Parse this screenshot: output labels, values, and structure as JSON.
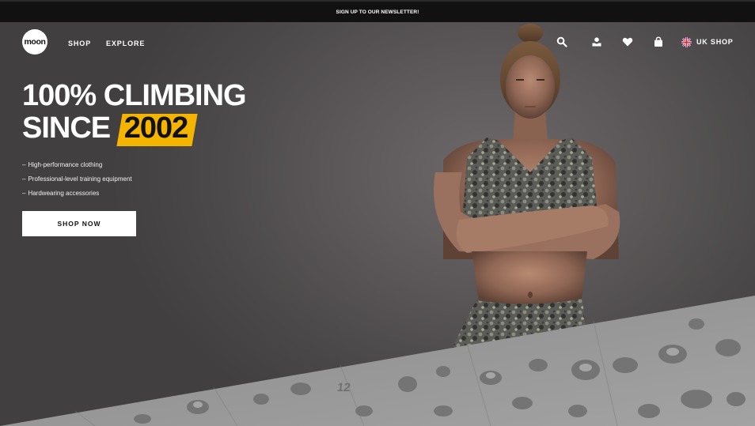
{
  "announcement": {
    "text": "SIGN UP TO OUR NEWSLETTER!"
  },
  "header": {
    "logo_text": "moon",
    "nav": [
      {
        "label": "SHOP"
      },
      {
        "label": "EXPLORE"
      }
    ],
    "utility_icons": [
      "search-icon",
      "account-icon",
      "heart-icon",
      "bag-icon"
    ],
    "shop_switch": {
      "flag_icon": "uk-flag-icon",
      "label": "UK SHOP"
    }
  },
  "hero": {
    "headline_line1": "100% CLIMBING",
    "headline_line2_prefix": "SINCE",
    "headline_highlight": "2002",
    "bullets": [
      {
        "dash": "–",
        "text": "High-performance clothing"
      },
      {
        "dash": "–",
        "text": "Professional-level training equipment"
      },
      {
        "dash": "–",
        "text": "Hardwearing accessories"
      }
    ],
    "cta_label": "SHOP NOW",
    "panel_number": "12"
  },
  "colors": {
    "background": "#4a4748",
    "announcement_bar": "#111111",
    "accent": "#f5b400",
    "text": "#ffffff"
  }
}
